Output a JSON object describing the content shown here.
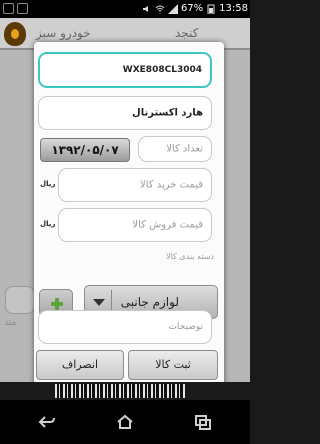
{
  "status_bar": {
    "battery": "67%",
    "time": "13:58"
  },
  "background_app": {
    "title_left": "خودرو سبز",
    "title_right": "کنجد",
    "partial_label": "متد"
  },
  "dialog": {
    "barcode_value": "WXE808CL3004",
    "product_name": "هارد اکسترنال",
    "quantity_placeholder": "تعداد کالا",
    "date_label": "۱۳۹۲/۰۵/۰۷",
    "buy_price_placeholder": "قیمت خرید کالا",
    "sell_price_placeholder": "قیمت فروش کالا",
    "currency": "ریال",
    "category_section_label": "دسته بندی کالا",
    "category_selected": "لوازم جانبی",
    "description_placeholder": "توضیحات",
    "save_label": "ثبت کالا",
    "cancel_label": "انصراف"
  },
  "colors": {
    "focus_accent": "#3cc8c4",
    "add_plus": "#5ea33a"
  }
}
